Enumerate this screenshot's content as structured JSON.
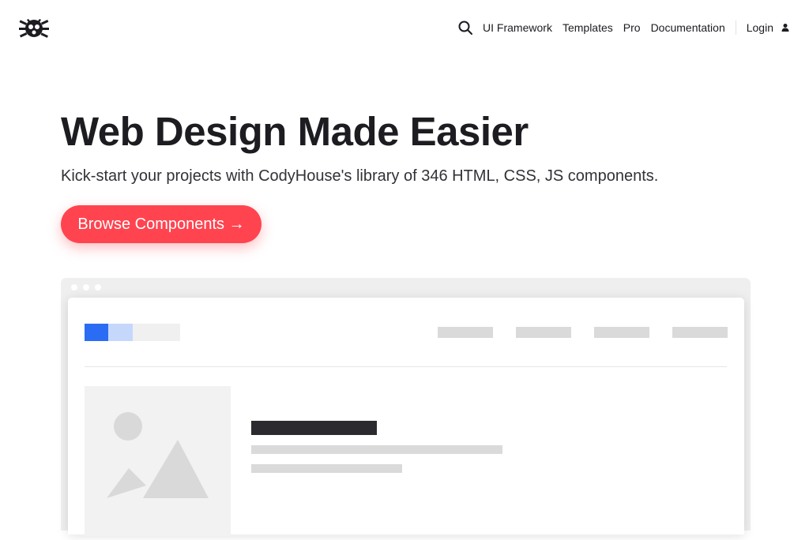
{
  "header": {
    "logo": {
      "icon": "bug-icon"
    },
    "search": {
      "icon": "search-icon"
    },
    "nav": {
      "items": [
        {
          "label": "UI Framework"
        },
        {
          "label": "Templates"
        },
        {
          "label": "Pro"
        },
        {
          "label": "Documentation"
        }
      ],
      "login_label": "Login",
      "login_icon": "user-icon"
    }
  },
  "hero": {
    "title": "Web Design Made Easier",
    "subtitle": "Kick-start your projects with CodyHouse's library of 346 HTML, CSS, JS components.",
    "cta_label": "Browse Components →"
  },
  "colors": {
    "accent": "#ff4450",
    "primary_blue": "#2a6df4",
    "light_blue": "#c5d8fc",
    "text": "#1c1c21"
  },
  "preview": {
    "image_icon": "image-placeholder-icon"
  }
}
